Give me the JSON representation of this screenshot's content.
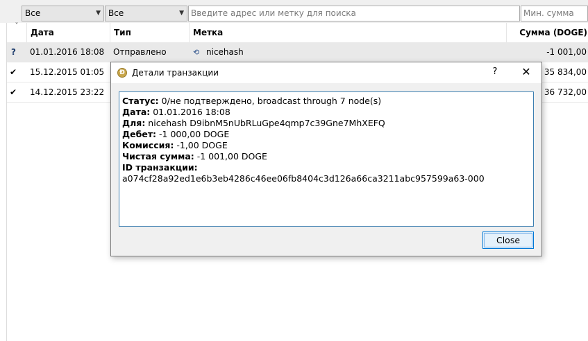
{
  "filters": {
    "date_filter": "Все",
    "type_filter": "Все",
    "search_placeholder": "Введите адрес или метку для поиска",
    "min_amount_placeholder": "Мин. сумма"
  },
  "table": {
    "sort_indicator": "˅",
    "columns": {
      "date": "Дата",
      "type": "Тип",
      "label": "Метка",
      "amount": "Сумма (DOGE)"
    },
    "rows": [
      {
        "status": "?",
        "date": "01.01.2016 18:08",
        "type": "Отправлено",
        "label": "nicehash",
        "amount": "-1 001,00"
      },
      {
        "status": "✔",
        "date": "15.12.2015 01:05",
        "type": "",
        "label": "",
        "amount": "35 834,00"
      },
      {
        "status": "✔",
        "date": "14.12.2015 23:22",
        "type": "",
        "label": "",
        "amount": "36 732,00"
      }
    ]
  },
  "dialog": {
    "title": "Детали транзакции",
    "help_label": "?",
    "close_x": "✕",
    "details": {
      "status_label": "Статус:",
      "status_value": " 0/не подтверждено, broadcast through 7 node(s)",
      "date_label": "Дата:",
      "date_value": " 01.01.2016 18:08",
      "to_label": "Для:",
      "to_value": " nicehash D9ibnM5nUbRLuGpe4qmp7c39Gne7MhXEFQ",
      "debit_label": "Дебет:",
      "debit_value": " -1 000,00 DOGE",
      "fee_label": "Комиссия:",
      "fee_value": " -1,00 DOGE",
      "net_label": "Чистая сумма:",
      "net_value": " -1 001,00 DOGE",
      "txid_label": "ID транзакции:",
      "txid_value": "a074cf28a92ed1e6b3eb4286c46ee06fb8404c3d126a66ca3211abc957599a63-000"
    },
    "close_button": "Close"
  }
}
